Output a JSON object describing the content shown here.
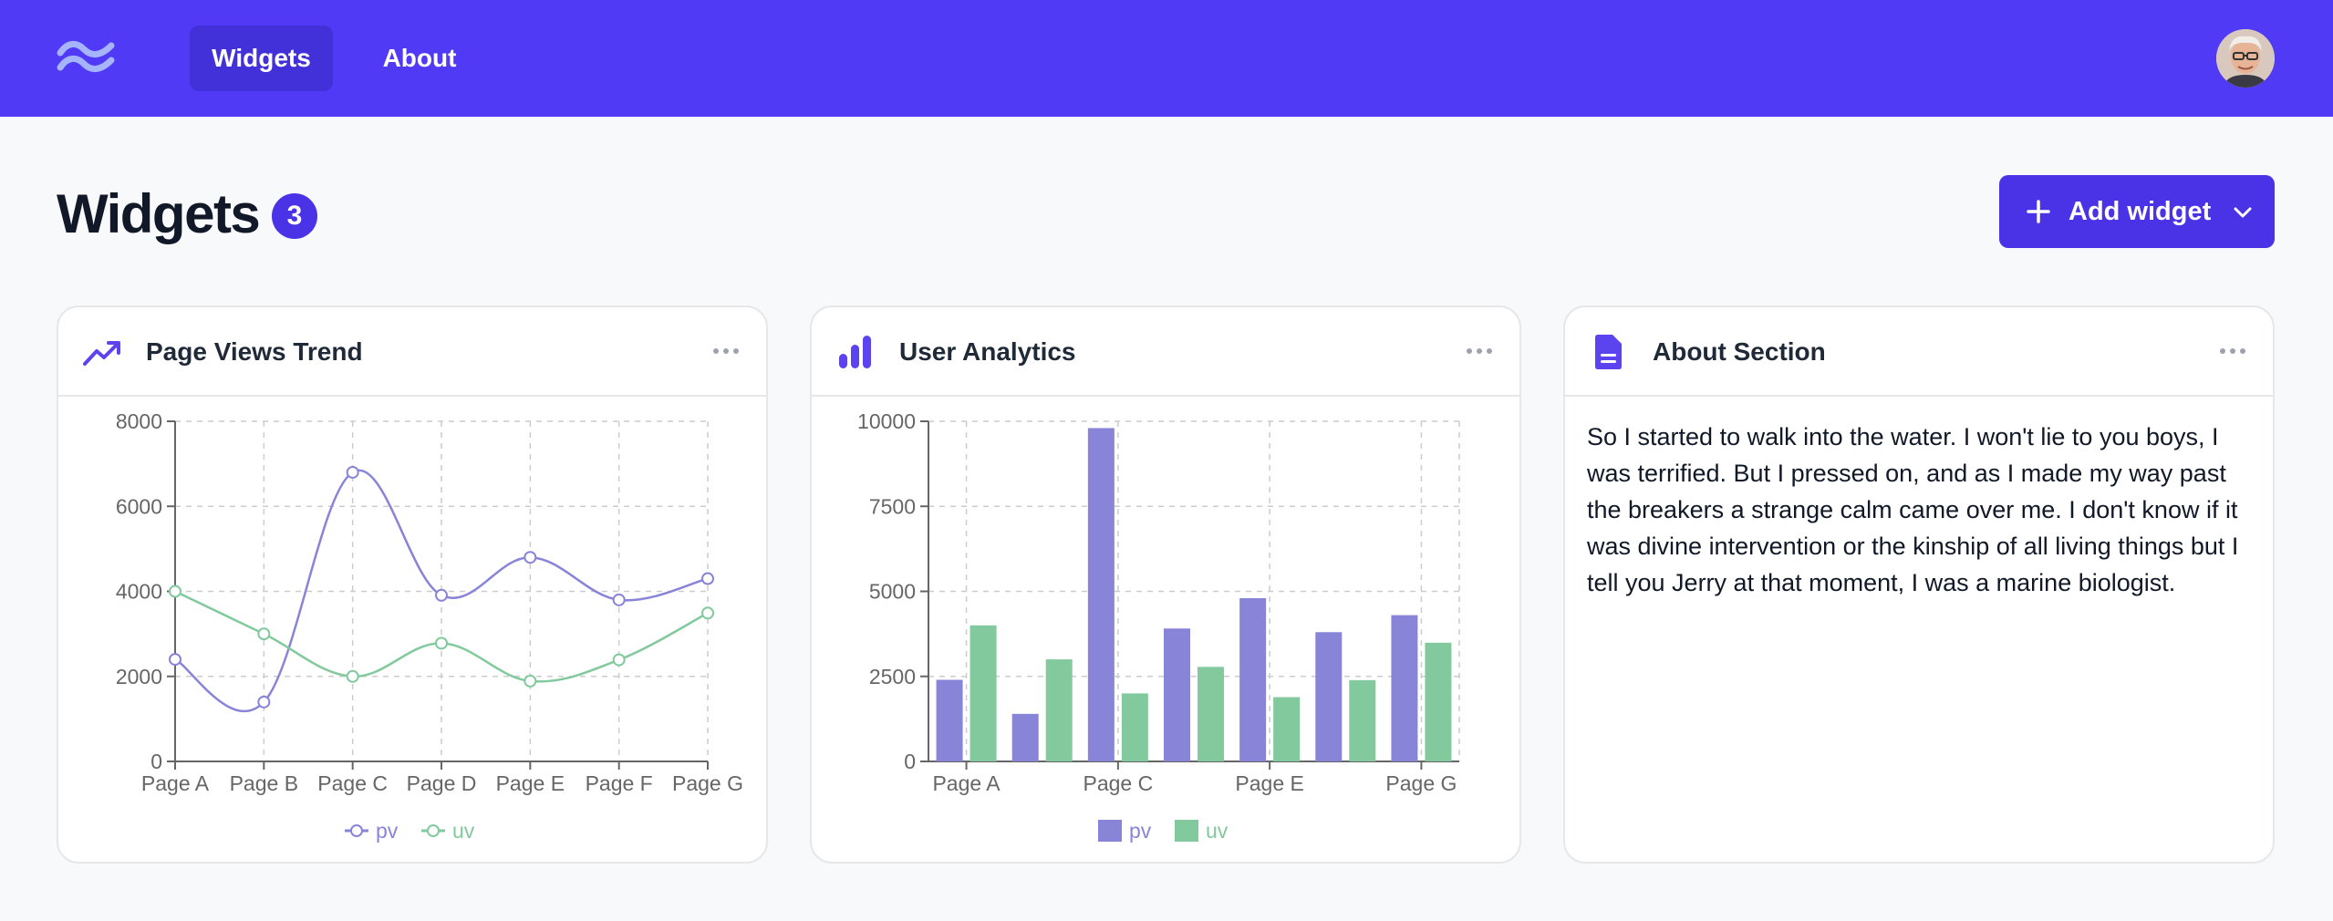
{
  "nav": {
    "logo_icon": "tailwind-logo-icon",
    "tabs": [
      {
        "label": "Widgets",
        "active": true
      },
      {
        "label": "About",
        "active": false
      }
    ],
    "avatar_icon": "user-avatar"
  },
  "header": {
    "title": "Widgets",
    "count": "3",
    "add_button_label": "Add widget"
  },
  "colors": {
    "brand": "#513af5",
    "accent": "#4a33e6",
    "pv": "#8884d8",
    "uv": "#82ca9d"
  },
  "widgets": [
    {
      "title": "Page Views Trend",
      "icon": "trending-up-icon"
    },
    {
      "title": "User Analytics",
      "icon": "bar-chart-icon"
    },
    {
      "title": "About Section",
      "icon": "document-icon",
      "text": "So I started to walk into the water. I won't lie to you boys, I was terrified. But I pressed on, and as I made my way past the breakers a strange calm came over me. I don't know if it was divine intervention or the kinship of all living things but I tell you Jerry at that moment, I was a marine biologist."
    }
  ],
  "chart_data": [
    {
      "type": "line",
      "categories": [
        "Page A",
        "Page B",
        "Page C",
        "Page D",
        "Page E",
        "Page F",
        "Page G"
      ],
      "series": [
        {
          "name": "pv",
          "values": [
            2400,
            1398,
            6800,
            3908,
            4800,
            3800,
            4300
          ]
        },
        {
          "name": "uv",
          "values": [
            4000,
            3000,
            2000,
            2780,
            1890,
            2390,
            3490
          ]
        }
      ],
      "y_ticks": [
        "0",
        "2000",
        "4000",
        "6000",
        "8000"
      ],
      "ylim": [
        0,
        8000
      ],
      "grid": true,
      "legend": "bottom"
    },
    {
      "type": "bar",
      "categories": [
        "Page A",
        "Page B",
        "Page C",
        "Page D",
        "Page E",
        "Page F",
        "Page G"
      ],
      "x_tick_labels": [
        "Page A",
        "Page C",
        "Page E",
        "Page G"
      ],
      "series": [
        {
          "name": "pv",
          "values": [
            2400,
            1398,
            9800,
            3908,
            4800,
            3800,
            4300
          ]
        },
        {
          "name": "uv",
          "values": [
            4000,
            3000,
            2000,
            2780,
            1890,
            2390,
            3490
          ]
        }
      ],
      "y_ticks": [
        "0",
        "2500",
        "5000",
        "7500",
        "10000"
      ],
      "ylim": [
        0,
        10000
      ],
      "grid": true,
      "legend": "bottom"
    }
  ]
}
